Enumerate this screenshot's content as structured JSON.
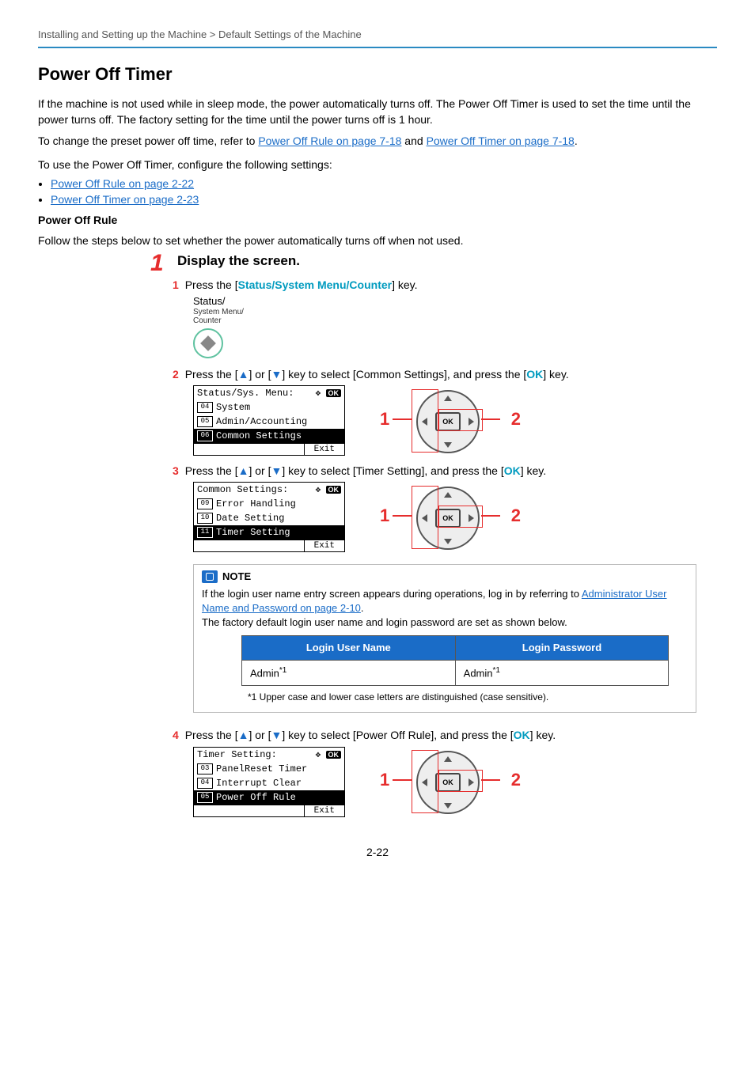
{
  "breadcrumb": "Installing and Setting up the Machine > Default Settings of the Machine",
  "title": "Power Off Timer",
  "intro": {
    "p1": "If the machine is not used while in sleep mode, the power automatically turns off. The Power Off Timer is used to set the time until the power turns off. The factory setting for the time until the power turns off is 1 hour.",
    "p2_pre": "To change the preset power off time, refer to ",
    "p2_link1": "Power Off Rule on page 7-18",
    "p2_and": " and ",
    "p2_link2": "Power Off Timer on page 7-18",
    "p3": "To use the Power Off Timer, configure the following settings:"
  },
  "bullets": [
    "Power Off Rule on page 2-22",
    "Power Off Timer on page 2-23"
  ],
  "subheading": "Power Off Rule",
  "subheading_desc": "Follow the steps below to set whether the power automatically turns off when not used.",
  "step1": {
    "num": "1",
    "heading": "Display the screen.",
    "sub1": {
      "num": "1",
      "pre": "Press the [",
      "key": "Status/System Menu/Counter",
      "post": "] key."
    },
    "status_btn": {
      "line1": "Status/",
      "line2": "System Menu/",
      "line3": "Counter"
    },
    "sub2": {
      "num": "2",
      "text_pre": "Press the [",
      "text_mid1": "] or [",
      "text_mid2": "] key to select [Common Settings], and press the [",
      "ok": "OK",
      "text_post": "] key."
    },
    "lcd1": {
      "title": "Status/Sys. Menu:",
      "items": [
        {
          "n": "04",
          "t": "System",
          "sel": false
        },
        {
          "n": "05",
          "t": "Admin/Accounting",
          "sel": false
        },
        {
          "n": "06",
          "t": "Common Settings",
          "sel": true
        }
      ],
      "exit": "Exit"
    },
    "sub3": {
      "num": "3",
      "text_pre": "Press the [",
      "text_mid1": "] or [",
      "text_mid2": "] key to select [Timer Setting], and press the [",
      "ok": "OK",
      "text_post": "] key."
    },
    "lcd2": {
      "title": "Common Settings:",
      "items": [
        {
          "n": "09",
          "t": "Error Handling",
          "sel": false
        },
        {
          "n": "10",
          "t": "Date Setting",
          "sel": false
        },
        {
          "n": "11",
          "t": "Timer Setting",
          "sel": true
        }
      ],
      "exit": "Exit"
    },
    "note": {
      "label": "NOTE",
      "text_pre": "If the login user name entry screen appears during operations, log in by referring to ",
      "link": "Administrator User Name and Password on page 2-10",
      "text_post": ".",
      "text2": "The factory default login user name and login password are set as shown below.",
      "table": {
        "h1": "Login User Name",
        "h2": "Login Password",
        "c1": "Admin",
        "c2": "Admin",
        "mark": "*1"
      },
      "footnote": "*1   Upper case and lower case letters are distinguished (case sensitive)."
    },
    "sub4": {
      "num": "4",
      "text_pre": "Press the [",
      "text_mid1": "] or [",
      "text_mid2": "] key to select [Power Off Rule], and press the [",
      "ok": "OK",
      "text_post": "] key."
    },
    "lcd3": {
      "title": "Timer Setting:",
      "items": [
        {
          "n": "03",
          "t": "PanelReset Timer",
          "sel": false
        },
        {
          "n": "04",
          "t": "Interrupt Clear",
          "sel": false
        },
        {
          "n": "05",
          "t": "Power Off Rule",
          "sel": true
        }
      ],
      "exit": "Exit"
    },
    "wheel": {
      "left_num": "1",
      "right_num": "2"
    }
  },
  "page_number": "2-22"
}
